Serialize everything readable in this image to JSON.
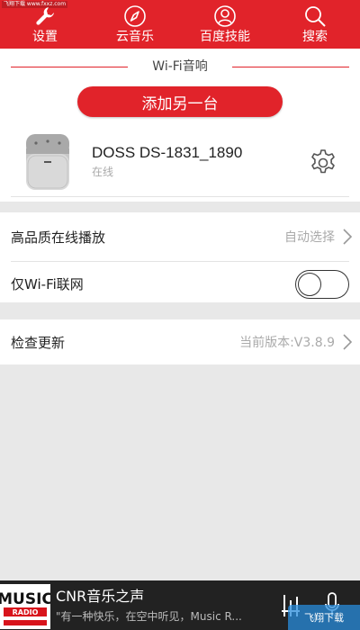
{
  "watermark_top": "飞翔下载 www.fxxz.com",
  "nav": [
    {
      "label": "设置",
      "icon": "wrench-icon"
    },
    {
      "label": "云音乐",
      "icon": "compass-icon"
    },
    {
      "label": "百度技能",
      "icon": "person-icon"
    },
    {
      "label": "搜索",
      "icon": "search-icon"
    }
  ],
  "speakers_section": {
    "title": "Wi-Fi音响",
    "add_button": "添加另一台",
    "device": {
      "name": "DOSS DS-1831_1890",
      "status": "在线"
    }
  },
  "settings": {
    "hq_playback": {
      "label": "高品质在线播放",
      "value": "自动选择"
    },
    "wifi_only": {
      "label": "仅Wi-Fi联网",
      "enabled": false
    },
    "check_update": {
      "label": "检查更新",
      "value": "当前版本:V3.8.9"
    }
  },
  "player": {
    "logo_text": "MUSIC",
    "logo_sub": "RADIO",
    "title": "CNR音乐之声",
    "subtitle": "\"有一种快乐，在空中听见，Music R..."
  },
  "watermark_bottom": "飞翔下载"
}
